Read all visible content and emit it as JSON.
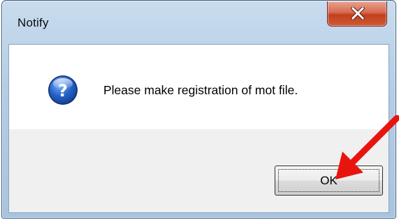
{
  "dialog": {
    "title": "Notify",
    "message": "Please make registration of mot file.",
    "ok_label": "OK",
    "icon": "question-icon",
    "close_icon": "close-icon"
  },
  "annotation": {
    "arrow_color": "#e8140e"
  },
  "colors": {
    "titlebar": "#b4cde6",
    "close_button": "#c2401f",
    "question_icon": "#1d5fb5"
  }
}
